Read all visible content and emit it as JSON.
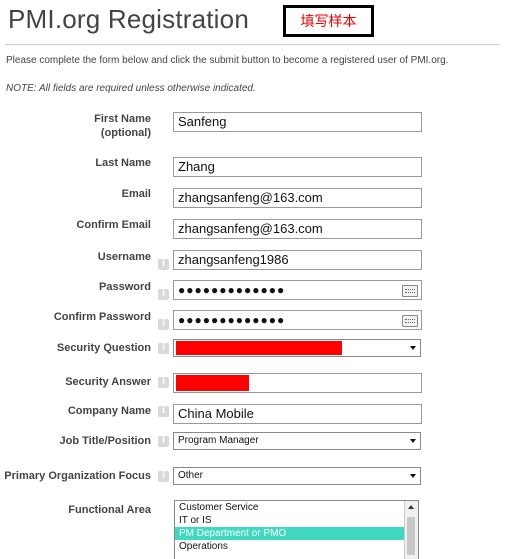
{
  "header": {
    "title": "PMI.org Registration",
    "sample_stamp": "填写样本"
  },
  "intro": "Please complete the form below and click the submit button to become a registered user of PMI.org.",
  "note": "NOTE: All fields are required unless otherwise indicated.",
  "info_glyph": "i",
  "fields": {
    "first_name": {
      "label_line1": "First Name",
      "label_line2": "(optional)",
      "value": "Sanfeng"
    },
    "last_name": {
      "label": "Last Name",
      "value": "Zhang"
    },
    "email": {
      "label": "Email",
      "value": "zhangsanfeng@163.com"
    },
    "confirm_email": {
      "label": "Confirm Email",
      "value": "zhangsanfeng@163.com"
    },
    "username": {
      "label": "Username",
      "value": "zhangsanfeng1986"
    },
    "password": {
      "label": "Password",
      "value": "●●●●●●●●●●●●●"
    },
    "confirm_password": {
      "label": "Confirm Password",
      "value": "●●●●●●●●●●●●●"
    },
    "security_question": {
      "label": "Security Question"
    },
    "security_answer": {
      "label": "Security Answer"
    },
    "company_name": {
      "label": "Company Name",
      "value": "China Mobile"
    },
    "job_title": {
      "label": "Job Title/Position",
      "value": "Program Manager"
    },
    "org_focus": {
      "label": "Primary Organization Focus",
      "value": "Other"
    },
    "functional_area": {
      "label": "Functional Area",
      "options": [
        "Customer Service",
        "IT or IS",
        "PM Department or PMO",
        "Operations"
      ],
      "selected": "PM Department or PMO"
    }
  },
  "colors": {
    "redaction": "#ff0000",
    "selected_option": "#40d9c0",
    "stamp_text": "#e00000"
  }
}
